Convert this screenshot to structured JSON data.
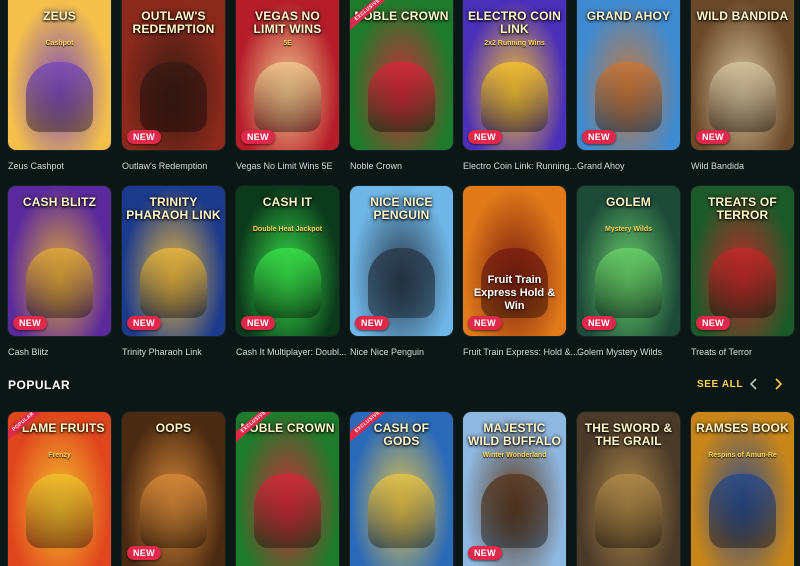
{
  "row1": [
    {
      "name": "Zeus Cashpot",
      "title": "Zeus",
      "sub": "Cashpot",
      "badge": "",
      "corner": "",
      "colors": [
        "#f4c04b",
        "#7b4bb8"
      ]
    },
    {
      "name": "Outlaw's Redemption",
      "title": "Outlaw's Redemption",
      "sub": "",
      "badge": "NEW",
      "corner": "",
      "colors": [
        "#8b2a1c",
        "#3a1a14"
      ]
    },
    {
      "name": "Vegas No Limit Wins 5E",
      "title": "Vegas No Limit Wins",
      "sub": "5E",
      "badge": "NEW",
      "corner": "",
      "colors": [
        "#b51d2a",
        "#f1c88e"
      ]
    },
    {
      "name": "Noble Crown",
      "title": "Noble Crown",
      "sub": "",
      "badge": "",
      "corner": "EXCLUSIVE",
      "colors": [
        "#1e7a2c",
        "#d22a3a"
      ]
    },
    {
      "name": "Electro Coin Link: Running...",
      "title": "Electro Coin Link",
      "sub": "2x2 Running Wins",
      "badge": "NEW",
      "corner": "",
      "colors": [
        "#4a2fb8",
        "#f5c233"
      ]
    },
    {
      "name": "Grand Ahoy",
      "title": "Grand Ahoy",
      "sub": "",
      "badge": "NEW",
      "corner": "",
      "colors": [
        "#3f8bd1",
        "#c8773a"
      ]
    },
    {
      "name": "Wild Bandida",
      "title": "Wild Bandida",
      "sub": "",
      "badge": "NEW",
      "corner": "",
      "colors": [
        "#6b4a2a",
        "#d7c4a0"
      ]
    }
  ],
  "row2": [
    {
      "name": "Cash Blitz",
      "title": "Cash Blitz",
      "sub": "",
      "badge": "NEW",
      "corner": "",
      "colors": [
        "#5a2a9c",
        "#e0a93a"
      ]
    },
    {
      "name": "Trinity Pharaoh Link",
      "title": "Trinity Pharaoh Link",
      "sub": "",
      "badge": "NEW",
      "corner": "",
      "colors": [
        "#1d3b8c",
        "#e6b640"
      ]
    },
    {
      "name": "Cash It Multiplayer: Doubl...",
      "title": "Cash It",
      "sub": "Double Heat Jackpot",
      "badge": "NEW",
      "corner": "",
      "colors": [
        "#0c3a1c",
        "#39e04a"
      ]
    },
    {
      "name": "Nice Nice Penguin",
      "title": "Nice Nice Penguin",
      "sub": "",
      "badge": "NEW",
      "corner": "",
      "colors": [
        "#6fb6e6",
        "#2b3b4c"
      ]
    },
    {
      "name": "Fruit Train Express: Hold &...",
      "title": "",
      "sub": "",
      "center": "Fruit Train Express Hold & Win",
      "badge": "NEW",
      "corner": "",
      "colors": [
        "#e07a1a",
        "#7a1e10"
      ]
    },
    {
      "name": "Golem Mystery Wilds",
      "title": "Golem",
      "sub": "Mystery Wilds",
      "badge": "NEW",
      "corner": "",
      "colors": [
        "#1e4a3a",
        "#6ad16a"
      ]
    },
    {
      "name": "Treats of Terror",
      "title": "Treats of Terror",
      "sub": "",
      "badge": "NEW",
      "corner": "",
      "colors": [
        "#1d5a2a",
        "#c22a2a"
      ]
    }
  ],
  "section": {
    "title": "POPULAR",
    "see_all": "SEE ALL"
  },
  "row3": [
    {
      "title": "Flame Fruits",
      "sub": "Frenzy",
      "badge": "",
      "corner": "POPULAR",
      "colors": [
        "#e0461e",
        "#f3c12e"
      ]
    },
    {
      "title": "Oops",
      "sub": "",
      "badge": "NEW",
      "corner": "",
      "colors": [
        "#4a2a12",
        "#d88a3a"
      ]
    },
    {
      "title": "Noble Crown",
      "sub": "",
      "badge": "",
      "corner": "EXCLUSIVE",
      "colors": [
        "#1e7a2c",
        "#d22a3a"
      ]
    },
    {
      "title": "Cash of Gods",
      "sub": "",
      "badge": "",
      "corner": "EXCLUSIVE",
      "colors": [
        "#2a6ab8",
        "#e6c44a"
      ]
    },
    {
      "title": "Majestic Wild Buffalo",
      "sub": "Winter Wonderland",
      "badge": "NEW",
      "corner": "",
      "colors": [
        "#8fb8e0",
        "#5a3a22"
      ]
    },
    {
      "title": "The Sword & The Grail",
      "sub": "",
      "badge": "",
      "corner": "",
      "colors": [
        "#4a3a2a",
        "#b08a4a"
      ]
    },
    {
      "title": "Ramses Book",
      "sub": "Respins of Amun-Re",
      "badge": "",
      "corner": "",
      "colors": [
        "#c8861a",
        "#2a4a8a"
      ]
    }
  ]
}
